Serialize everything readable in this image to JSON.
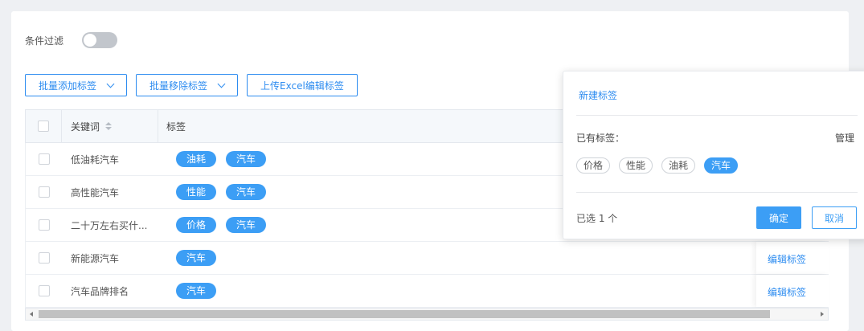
{
  "filter": {
    "label": "条件过滤",
    "enabled": false
  },
  "actions": {
    "batch_add": "批量添加标签",
    "batch_remove": "批量移除标签",
    "upload_excel": "上传Excel编辑标签"
  },
  "table": {
    "columns": {
      "keyword": "关键词",
      "tags": "标签"
    },
    "rows": [
      {
        "keyword": "低油耗汽车",
        "tags": [
          "油耗",
          "汽车"
        ]
      },
      {
        "keyword": "高性能汽车",
        "tags": [
          "性能",
          "汽车"
        ]
      },
      {
        "keyword": "二十万左右买什...",
        "tags": [
          "价格",
          "汽车"
        ]
      },
      {
        "keyword": "新能源汽车",
        "tags": [
          "汽车"
        ],
        "action": "编辑标签"
      },
      {
        "keyword": "汽车品牌排名",
        "tags": [
          "汽车"
        ],
        "action": "编辑标签"
      }
    ]
  },
  "popover": {
    "new_tag": "新建标签",
    "existing_label": "已有标签：",
    "manage": "管理",
    "tags": [
      {
        "label": "价格",
        "selected": false
      },
      {
        "label": "性能",
        "selected": false
      },
      {
        "label": "油耗",
        "selected": false
      },
      {
        "label": "汽车",
        "selected": true
      }
    ],
    "selected_count": "已选 1 个",
    "confirm": "确定",
    "cancel": "取消"
  },
  "colors": {
    "accent": "#2d8cf0",
    "tag_bg": "#3c9ef5",
    "switch_off": "#c2c6cc"
  }
}
